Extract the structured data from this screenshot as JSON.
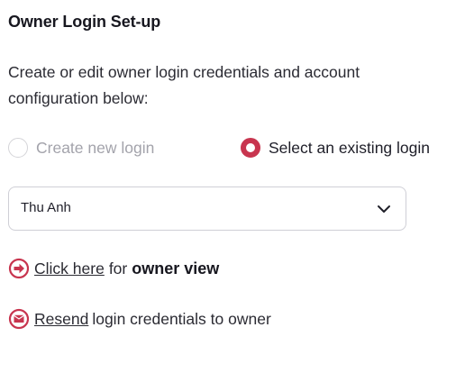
{
  "header": {
    "title": "Owner Login Set-up"
  },
  "description": "Create or edit owner login credentials and account configuration below:",
  "login_mode": {
    "options": [
      {
        "label": "Create new login",
        "selected": false
      },
      {
        "label": "Select an existing login",
        "selected": true
      }
    ]
  },
  "login_select": {
    "value": "Thu Anh"
  },
  "owner_view": {
    "link_text": "Click here",
    "middle_text": "for",
    "emphasis_text": "owner view"
  },
  "resend": {
    "link_text": "Resend",
    "rest_text": "login credentials to owner"
  },
  "icons": {
    "owner_view": "arrow-right-circle-icon",
    "resend": "envelope-circle-icon",
    "select": "chevron-down-icon"
  },
  "colors": {
    "accent": "#c8354f",
    "text": "#1f1f29",
    "muted": "#a3a3ab",
    "border": "#cfcfd6"
  }
}
